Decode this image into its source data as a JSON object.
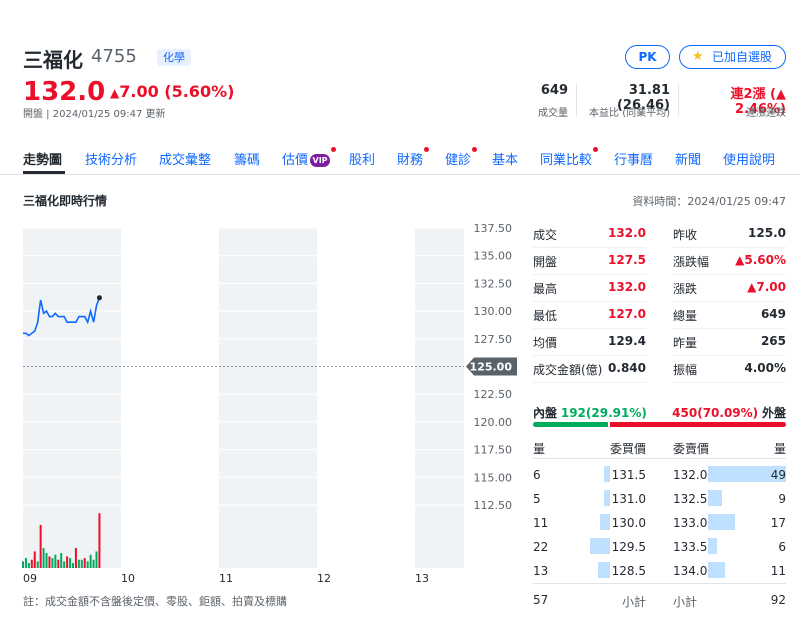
{
  "header": {
    "name": "三福化",
    "code": "4755",
    "industry": "化學",
    "pk_label": "PK",
    "watchlist_label": "已加自選股",
    "price": "132.0",
    "change_text": "7.00 (5.60%)",
    "meta": "開盤 | 2024/01/25 09:47 更新",
    "stats": [
      {
        "value": "649",
        "label": "成交量"
      },
      {
        "value": "31.81 (26.46)",
        "label": "本益比 (同業平均)"
      },
      {
        "value": "連2漲 (▲ 2.46%)",
        "label": "連漲連跌"
      }
    ]
  },
  "tabs": [
    {
      "label": "走勢圖",
      "active": true,
      "dot": false,
      "vip": false
    },
    {
      "label": "技術分析",
      "active": false,
      "dot": false,
      "vip": false
    },
    {
      "label": "成交彙整",
      "active": false,
      "dot": false,
      "vip": false
    },
    {
      "label": "籌碼",
      "active": false,
      "dot": false,
      "vip": false
    },
    {
      "label": "估價",
      "active": false,
      "dot": true,
      "vip": true
    },
    {
      "label": "股利",
      "active": false,
      "dot": false,
      "vip": false
    },
    {
      "label": "財務",
      "active": false,
      "dot": true,
      "vip": false
    },
    {
      "label": "健診",
      "active": false,
      "dot": true,
      "vip": false
    },
    {
      "label": "基本",
      "active": false,
      "dot": false,
      "vip": false
    },
    {
      "label": "同業比較",
      "active": false,
      "dot": true,
      "vip": false
    },
    {
      "label": "行事曆",
      "active": false,
      "dot": false,
      "vip": false
    },
    {
      "label": "新聞",
      "active": false,
      "dot": false,
      "vip": false
    },
    {
      "label": "使用說明",
      "active": false,
      "dot": false,
      "vip": false
    }
  ],
  "vip_badge": "VIP",
  "section_title": "三福化即時行情",
  "data_time": "資料時間：2024/01/25 09:47",
  "chart_data": {
    "type": "line",
    "y_ticks": [
      "137.50",
      "135.00",
      "132.50",
      "130.00",
      "127.50",
      "125.00",
      "122.50",
      "120.00",
      "117.50",
      "115.00",
      "112.50"
    ],
    "x_ticks": [
      "09",
      "10",
      "11",
      "12",
      "13"
    ],
    "ylim": [
      112.5,
      137.5
    ],
    "prev_close": 125.0,
    "reference_label": "125.00",
    "x": [
      9.0,
      9.03,
      9.06,
      9.09,
      9.12,
      9.15,
      9.18,
      9.21,
      9.24,
      9.27,
      9.3,
      9.33,
      9.36,
      9.39,
      9.42,
      9.45,
      9.48,
      9.51,
      9.54,
      9.57,
      9.6,
      9.63,
      9.66,
      9.69,
      9.72,
      9.75,
      9.78
    ],
    "price": [
      128.0,
      128.0,
      127.8,
      128.0,
      128.2,
      129.0,
      131.0,
      129.8,
      130.0,
      129.5,
      129.5,
      129.8,
      129.5,
      129.5,
      129.5,
      129.0,
      129.0,
      129.0,
      129.0,
      129.5,
      129.5,
      129.5,
      129.0,
      130.0,
      129.0,
      130.5,
      131.2
    ],
    "volume": [
      4,
      6,
      3,
      5,
      10,
      4,
      26,
      12,
      9,
      7,
      6,
      8,
      5,
      9,
      4,
      7,
      6,
      3,
      12,
      5,
      5,
      6,
      4,
      8,
      5,
      10,
      33
    ],
    "volume_colors": [
      "#00ab5e",
      "#00ab5e",
      "#00ab5e",
      "#eb0f29",
      "#eb0f29",
      "#00ab5e",
      "#eb0f29",
      "#00ab5e",
      "#00ab5e",
      "#eb0f29",
      "#00ab5e",
      "#00ab5e",
      "#eb0f29",
      "#00ab5e",
      "#00ab5e",
      "#eb0f29",
      "#00ab5e",
      "#00ab5e",
      "#eb0f29",
      "#00ab5e",
      "#00ab5e",
      "#eb0f29",
      "#00ab5e",
      "#00ab5e",
      "#00ab5e",
      "#00ab5e",
      "#eb0f29"
    ],
    "line_color": "#0f69ff"
  },
  "quote": {
    "left": [
      {
        "label": "成交",
        "value": "132.0",
        "color": "#eb0f29"
      },
      {
        "label": "開盤",
        "value": "127.5",
        "color": "#eb0f29"
      },
      {
        "label": "最高",
        "value": "132.0",
        "color": "#eb0f29"
      },
      {
        "label": "最低",
        "value": "127.0",
        "color": "#eb0f29"
      },
      {
        "label": "均價",
        "value": "129.4",
        "color": "#232a31"
      },
      {
        "label": "成交金額(億)",
        "value": "0.840",
        "color": "#232a31"
      }
    ],
    "right": [
      {
        "label": "昨收",
        "value": "125.0",
        "color": "#232a31"
      },
      {
        "label": "漲跌幅",
        "value": "▲5.60%",
        "color": "#eb0f29"
      },
      {
        "label": "漲跌",
        "value": "▲7.00",
        "color": "#eb0f29"
      },
      {
        "label": "總量",
        "value": "649",
        "color": "#232a31"
      },
      {
        "label": "昨量",
        "value": "265",
        "color": "#232a31"
      },
      {
        "label": "振幅",
        "value": "4.00%",
        "color": "#232a31"
      }
    ]
  },
  "inout": {
    "inner_label": "內盤",
    "inner_value": "192(29.91%)",
    "outer_value": "450(70.09%)",
    "outer_label": "外盤",
    "inner_fraction": 0.2991
  },
  "orderbook": {
    "headers": [
      "量",
      "委買價",
      "委賣價",
      "量"
    ],
    "bids": [
      {
        "vol": "6",
        "price": "131.5",
        "level": 0.12
      },
      {
        "vol": "5",
        "price": "131.0",
        "level": 0.1
      },
      {
        "vol": "11",
        "price": "130.0",
        "level": 0.22
      },
      {
        "vol": "22",
        "price": "129.5",
        "level": 0.45
      },
      {
        "vol": "13",
        "price": "128.5",
        "level": 0.27
      }
    ],
    "asks": [
      {
        "price": "132.0",
        "vol": "49",
        "level": 1.0
      },
      {
        "price": "132.5",
        "vol": "9",
        "level": 0.18
      },
      {
        "price": "133.0",
        "vol": "17",
        "level": 0.35
      },
      {
        "price": "133.5",
        "vol": "6",
        "level": 0.12
      },
      {
        "price": "134.0",
        "vol": "11",
        "level": 0.22
      }
    ],
    "bid_total": "57",
    "subtotal_label": "小計",
    "ask_total": "92"
  },
  "note": "註：成交金額不含盤後定價、零股、鉅額、拍賣及標購",
  "colors": {
    "up": "#eb0f29",
    "down": "#00ab5e",
    "link": "#0f69ff"
  }
}
